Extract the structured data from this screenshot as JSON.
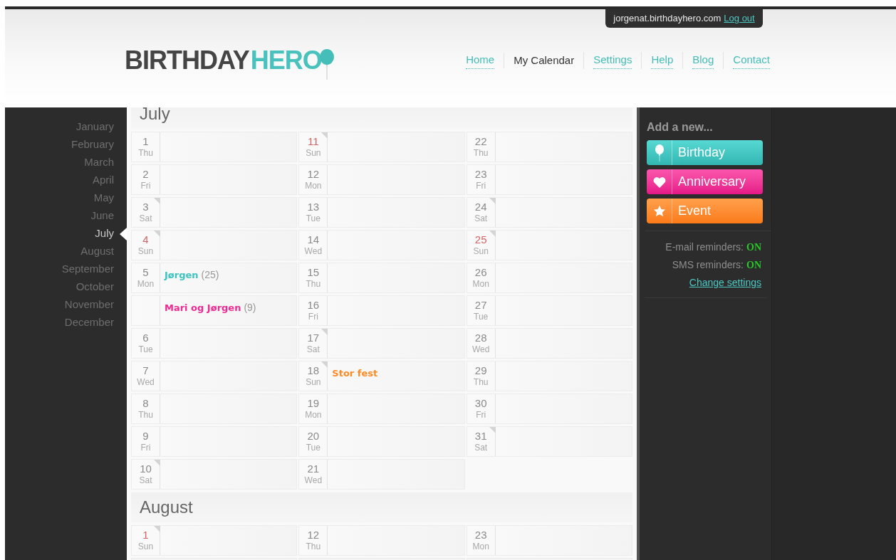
{
  "account": {
    "user": "jorgenat.birthdayhero.com",
    "logout": "Log out"
  },
  "logo": {
    "part1": "BIRTHDAY",
    "part2": "HERO"
  },
  "nav": [
    {
      "label": "Home",
      "selected": false
    },
    {
      "label": "My Calendar",
      "selected": true
    },
    {
      "label": "Settings",
      "selected": false
    },
    {
      "label": "Help",
      "selected": false
    },
    {
      "label": "Blog",
      "selected": false
    },
    {
      "label": "Contact",
      "selected": false
    }
  ],
  "months": [
    {
      "label": "January",
      "selected": false
    },
    {
      "label": "February",
      "selected": false
    },
    {
      "label": "March",
      "selected": false
    },
    {
      "label": "April",
      "selected": false
    },
    {
      "label": "May",
      "selected": false
    },
    {
      "label": "June",
      "selected": false
    },
    {
      "label": "July",
      "selected": true
    },
    {
      "label": "August",
      "selected": false
    },
    {
      "label": "September",
      "selected": false
    },
    {
      "label": "October",
      "selected": false
    },
    {
      "label": "November",
      "selected": false
    },
    {
      "label": "December",
      "selected": false
    }
  ],
  "calendar": [
    {
      "month": "July",
      "columns": [
        [
          {
            "day": "1",
            "weekday": "Thu",
            "weekend": false,
            "red": false
          },
          {
            "day": "2",
            "weekday": "Fri",
            "weekend": false,
            "red": false
          },
          {
            "day": "3",
            "weekday": "Sat",
            "weekend": true,
            "red": false
          },
          {
            "day": "4",
            "weekday": "Sun",
            "weekend": true,
            "red": true
          },
          {
            "day": "5",
            "weekday": "Mon",
            "weekend": false,
            "red": false,
            "event": {
              "kind": "birthday",
              "name": "Jørgen",
              "count": "(25)"
            }
          },
          {
            "weekend": false,
            "event": {
              "kind": "anniversary",
              "name": "Mari og Jørgen",
              "count": "(9)"
            }
          },
          {
            "day": "6",
            "weekday": "Tue",
            "weekend": false,
            "red": false
          },
          {
            "day": "7",
            "weekday": "Wed",
            "weekend": false,
            "red": false
          },
          {
            "day": "8",
            "weekday": "Thu",
            "weekend": false,
            "red": false
          },
          {
            "day": "9",
            "weekday": "Fri",
            "weekend": false,
            "red": false
          },
          {
            "day": "10",
            "weekday": "Sat",
            "weekend": true,
            "red": false
          }
        ],
        [
          {
            "day": "11",
            "weekday": "Sun",
            "weekend": true,
            "red": true
          },
          {
            "day": "12",
            "weekday": "Mon",
            "weekend": false,
            "red": false
          },
          {
            "day": "13",
            "weekday": "Tue",
            "weekend": false,
            "red": false
          },
          {
            "day": "14",
            "weekday": "Wed",
            "weekend": false,
            "red": false
          },
          {
            "day": "15",
            "weekday": "Thu",
            "weekend": false,
            "red": false
          },
          {
            "day": "16",
            "weekday": "Fri",
            "weekend": false,
            "red": false
          },
          {
            "day": "17",
            "weekday": "Sat",
            "weekend": true,
            "red": false
          },
          {
            "day": "18",
            "weekday": "Sun",
            "weekend": true,
            "red": false,
            "event": {
              "kind": "event",
              "name": "Stor fest"
            }
          },
          {
            "day": "19",
            "weekday": "Mon",
            "weekend": false,
            "red": false
          },
          {
            "day": "20",
            "weekday": "Tue",
            "weekend": false,
            "red": false
          },
          {
            "day": "21",
            "weekday": "Wed",
            "weekend": false,
            "red": false
          }
        ],
        [
          {
            "day": "22",
            "weekday": "Thu",
            "weekend": false,
            "red": false
          },
          {
            "day": "23",
            "weekday": "Fri",
            "weekend": false,
            "red": false
          },
          {
            "day": "24",
            "weekday": "Sat",
            "weekend": true,
            "red": false
          },
          {
            "day": "25",
            "weekday": "Sun",
            "weekend": true,
            "red": true
          },
          {
            "day": "26",
            "weekday": "Mon",
            "weekend": false,
            "red": false
          },
          {
            "day": "27",
            "weekday": "Tue",
            "weekend": false,
            "red": false
          },
          {
            "day": "28",
            "weekday": "Wed",
            "weekend": false,
            "red": false
          },
          {
            "day": "29",
            "weekday": "Thu",
            "weekend": false,
            "red": false
          },
          {
            "day": "30",
            "weekday": "Fri",
            "weekend": false,
            "red": false
          },
          {
            "day": "31",
            "weekday": "Sat",
            "weekend": true,
            "red": false
          }
        ]
      ]
    },
    {
      "month": "August",
      "columns": [
        [
          {
            "day": "1",
            "weekday": "Sun",
            "weekend": true,
            "red": true
          }
        ],
        [
          {
            "day": "12",
            "weekday": "Thu",
            "weekend": false,
            "red": false
          }
        ],
        [
          {
            "day": "23",
            "weekday": "Mon",
            "weekend": false,
            "red": false
          }
        ]
      ]
    }
  ],
  "add_new": {
    "title": "Add a new...",
    "buttons": [
      {
        "kind": "birthday",
        "label": "Birthday"
      },
      {
        "kind": "anniversary",
        "label": "Anniversary"
      },
      {
        "kind": "event",
        "label": "Event"
      }
    ]
  },
  "reminders": [
    {
      "label": "E-mail reminders:",
      "status": "ON",
      "on": true
    },
    {
      "label": "SMS reminders:",
      "status": "ON",
      "on": true
    }
  ],
  "change_settings": "Change settings"
}
